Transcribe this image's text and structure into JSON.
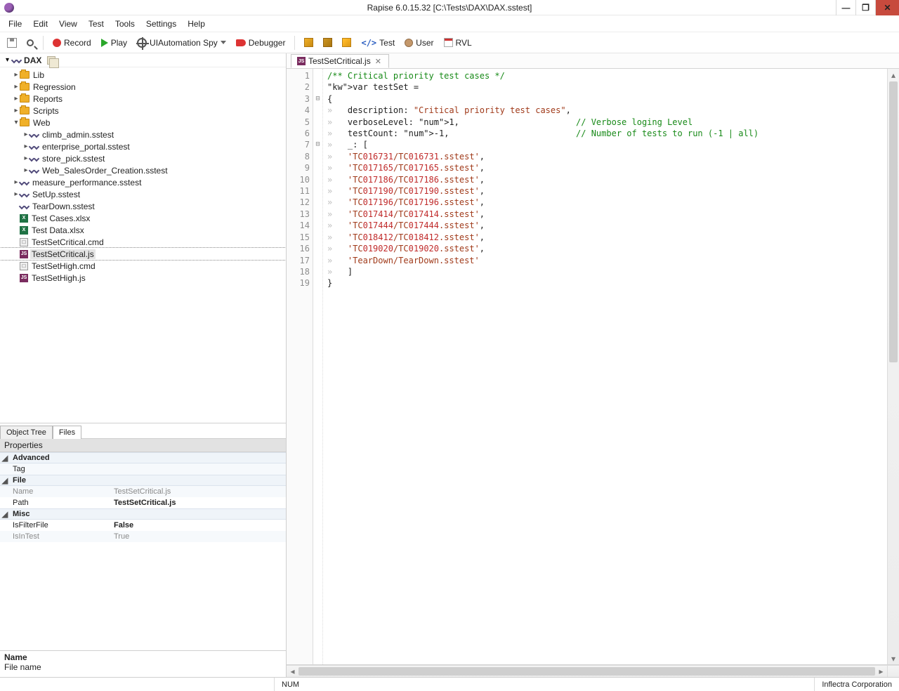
{
  "title": "Rapise 6.0.15.32  [C:\\Tests\\DAX\\DAX.sstest]",
  "menu": [
    "File",
    "Edit",
    "View",
    "Test",
    "Tools",
    "Settings",
    "Help"
  ],
  "toolbar": {
    "record": "Record",
    "play": "Play",
    "spy": "UIAutomation Spy",
    "debugger": "Debugger",
    "test": "Test",
    "user": "User",
    "rvl": "RVL"
  },
  "tree": {
    "root": "DAX",
    "nodes": [
      {
        "depth": 1,
        "type": "folder",
        "caret": "right",
        "name": "Lib"
      },
      {
        "depth": 1,
        "type": "folder",
        "caret": "right",
        "name": "Regression"
      },
      {
        "depth": 1,
        "type": "folder",
        "caret": "right",
        "name": "Reports"
      },
      {
        "depth": 1,
        "type": "folder",
        "caret": "right",
        "name": "Scripts"
      },
      {
        "depth": 1,
        "type": "folder",
        "caret": "down",
        "name": "Web"
      },
      {
        "depth": 2,
        "type": "sstest",
        "caret": "right",
        "name": "climb_admin.sstest"
      },
      {
        "depth": 2,
        "type": "sstest",
        "caret": "right",
        "name": "enterprise_portal.sstest"
      },
      {
        "depth": 2,
        "type": "sstest",
        "caret": "right",
        "name": "store_pick.sstest"
      },
      {
        "depth": 2,
        "type": "sstest",
        "caret": "right",
        "name": "Web_SalesOrder_Creation.sstest"
      },
      {
        "depth": 1,
        "type": "sstest",
        "caret": "right",
        "name": "measure_performance.sstest"
      },
      {
        "depth": 1,
        "type": "sstest",
        "caret": "right",
        "name": "SetUp.sstest"
      },
      {
        "depth": 1,
        "type": "sstest",
        "caret": "blank",
        "name": "TearDown.sstest"
      },
      {
        "depth": 1,
        "type": "xlsx",
        "caret": "blank",
        "name": "Test Cases.xlsx"
      },
      {
        "depth": 1,
        "type": "xlsx",
        "caret": "blank",
        "name": "Test Data.xlsx"
      },
      {
        "depth": 1,
        "type": "cmd",
        "caret": "blank",
        "name": "TestSetCritical.cmd"
      },
      {
        "depth": 1,
        "type": "js",
        "caret": "blank",
        "name": "TestSetCritical.js",
        "selected": true
      },
      {
        "depth": 1,
        "type": "cmd",
        "caret": "blank",
        "name": "TestSetHigh.cmd"
      },
      {
        "depth": 1,
        "type": "js",
        "caret": "blank",
        "name": "TestSetHigh.js"
      }
    ]
  },
  "leftTabs": {
    "objectTree": "Object Tree",
    "files": "Files"
  },
  "properties": {
    "header": "Properties",
    "groups": {
      "advanced": {
        "label": "Advanced",
        "rows": [
          {
            "name": "Tag",
            "value": ""
          }
        ]
      },
      "file": {
        "label": "File",
        "rows": [
          {
            "name": "Name",
            "value": "TestSetCritical.js",
            "gray": true
          },
          {
            "name": "Path",
            "value": "TestSetCritical.js",
            "bold": true
          }
        ]
      },
      "misc": {
        "label": "Misc",
        "rows": [
          {
            "name": "IsFilterFile",
            "value": "False",
            "bold": true
          },
          {
            "name": "IsInTest",
            "value": "True",
            "gray": true
          }
        ]
      }
    },
    "footer": {
      "title": "Name",
      "desc": "File name"
    }
  },
  "editor": {
    "tabLabel": "TestSetCritical.js",
    "lines": [
      {
        "n": 1,
        "fold": "",
        "raw": "/** Critical priority test cases */"
      },
      {
        "n": 2,
        "fold": "",
        "raw": "var testSet ="
      },
      {
        "n": 3,
        "fold": "⊟",
        "raw": "{"
      },
      {
        "n": 4,
        "fold": "",
        "raw": "    description: \"Critical priority test cases\","
      },
      {
        "n": 5,
        "fold": "",
        "raw": "    verboseLevel: 1,                       // Verbose loging Level"
      },
      {
        "n": 6,
        "fold": "",
        "raw": "    testCount: -1,                         // Number of tests to run (-1 | all)"
      },
      {
        "n": 7,
        "fold": "⊟",
        "raw": "    _: ["
      },
      {
        "n": 8,
        "fold": "",
        "raw": "    'TC016731/TC016731.sstest',"
      },
      {
        "n": 9,
        "fold": "",
        "raw": "    'TC017165/TC017165.sstest',"
      },
      {
        "n": 10,
        "fold": "",
        "raw": "    'TC017186/TC017186.sstest',"
      },
      {
        "n": 11,
        "fold": "",
        "raw": "    'TC017190/TC017190.sstest',"
      },
      {
        "n": 12,
        "fold": "",
        "raw": "    'TC017196/TC017196.sstest',"
      },
      {
        "n": 13,
        "fold": "",
        "raw": "    'TC017414/TC017414.sstest',"
      },
      {
        "n": 14,
        "fold": "",
        "raw": "    'TC017444/TC017444.sstest',"
      },
      {
        "n": 15,
        "fold": "",
        "raw": "    'TC018412/TC018412.sstest',"
      },
      {
        "n": 16,
        "fold": "",
        "raw": "    'TC019020/TC019020.sstest',"
      },
      {
        "n": 17,
        "fold": "",
        "raw": "    'TearDown/TearDown.sstest'"
      },
      {
        "n": 18,
        "fold": "",
        "raw": "    ]"
      },
      {
        "n": 19,
        "fold": "",
        "raw": "}"
      }
    ]
  },
  "status": {
    "num": "NUM",
    "company": "Inflectra Corporation"
  }
}
